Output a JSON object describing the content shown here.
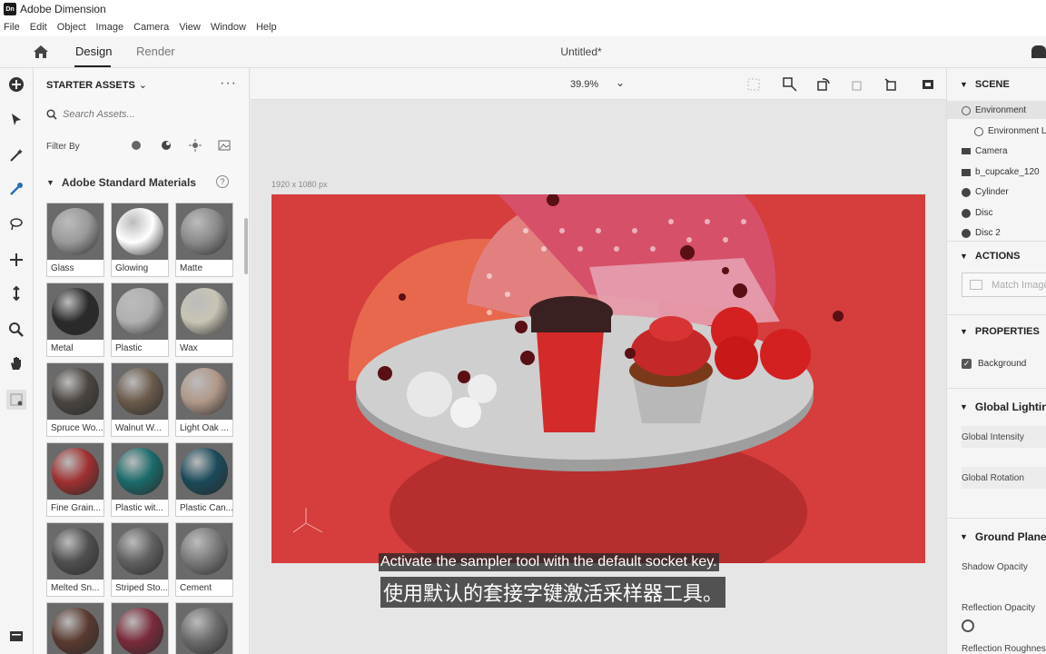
{
  "app": {
    "logo": "Dn",
    "title": "Adobe Dimension"
  },
  "menu": [
    "File",
    "Edit",
    "Object",
    "Image",
    "Camera",
    "View",
    "Window",
    "Help"
  ],
  "nav": {
    "tabs": [
      {
        "label": "Design",
        "active": true
      },
      {
        "label": "Render",
        "active": false
      }
    ],
    "doc_title": "Untitled*"
  },
  "assets": {
    "header": "STARTER ASSETS",
    "search_placeholder": "Search Assets...",
    "filter_label": "Filter By",
    "section_title": "Adobe Standard Materials",
    "help": "?",
    "tiles": [
      {
        "label": "Glass",
        "color": "#9a9a9a"
      },
      {
        "label": "Glowing",
        "color": "#ffffff"
      },
      {
        "label": "Matte",
        "color": "#8a8a8a"
      },
      {
        "label": "Metal",
        "color": "#2a2a2a"
      },
      {
        "label": "Plastic",
        "color": "#b0b0b0"
      },
      {
        "label": "Wax",
        "color": "#c8c4b4"
      },
      {
        "label": "Spruce Wo...",
        "color": "#4a4540"
      },
      {
        "label": "Walnut W...",
        "color": "#6a5a4a"
      },
      {
        "label": "Light Oak ...",
        "color": "#b09888"
      },
      {
        "label": "Fine Grain...",
        "color": "#a03030"
      },
      {
        "label": "Plastic wit...",
        "color": "#1a6a6a"
      },
      {
        "label": "Plastic Can...",
        "color": "#1a4a5a"
      },
      {
        "label": "Melted Sn...",
        "color": "#505050"
      },
      {
        "label": "Striped Sto...",
        "color": "#606060"
      },
      {
        "label": "Cement",
        "color": "#7a7a7a"
      },
      {
        "label": "",
        "color": "#5a3a30"
      },
      {
        "label": "",
        "color": "#7a2a3a"
      },
      {
        "label": "",
        "color": "#6a6a6a"
      }
    ]
  },
  "viewport": {
    "zoom": "39.9%",
    "canvas_size": "1920 x 1080 px",
    "background_color": "#d63d3d"
  },
  "subtitles": {
    "en": "Activate the sampler tool with the default socket key.",
    "zh": "使用默认的套接字键激活采样器工具。"
  },
  "scene": {
    "header": "SCENE",
    "items": [
      {
        "label": "Environment",
        "icon": "globe-icon",
        "selected": true
      },
      {
        "label": "Environment L",
        "icon": "globe-icon"
      },
      {
        "label": "Camera",
        "icon": "camera-icon"
      },
      {
        "label": "b_cupcake_120",
        "icon": "folder-icon"
      },
      {
        "label": "Cylinder",
        "icon": "material-icon"
      },
      {
        "label": "Disc",
        "icon": "material-icon"
      },
      {
        "label": "Disc 2",
        "icon": "material-icon"
      }
    ]
  },
  "actions": {
    "header": "ACTIONS",
    "match_image": "Match Image"
  },
  "properties": {
    "header": "PROPERTIES",
    "background": "Background",
    "global_lighting": "Global Lighting",
    "global_intensity": "Global Intensity",
    "global_rotation": "Global Rotation",
    "ground_plane": "Ground Plane",
    "shadow_opacity": "Shadow Opacity",
    "reflection_opacity": "Reflection Opacity",
    "reflection_roughness": "Reflection Roughness"
  }
}
